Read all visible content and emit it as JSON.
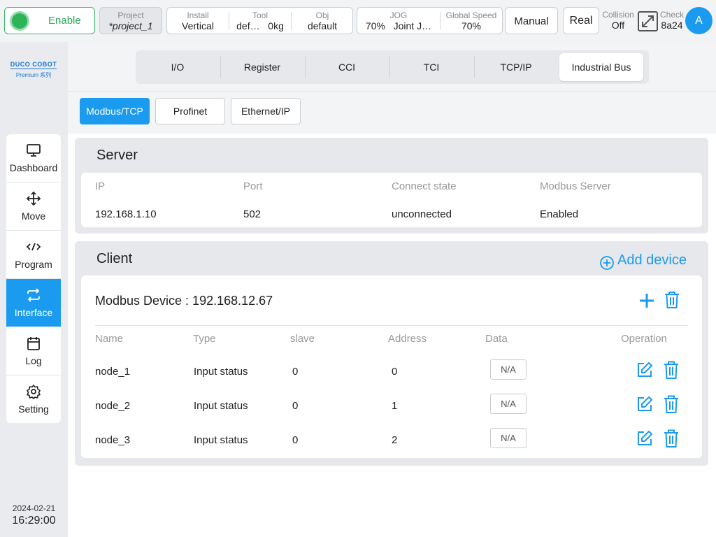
{
  "topbar": {
    "enable_label": "Enable",
    "project": {
      "label": "Project",
      "value": "*project_1"
    },
    "install": {
      "label": "Install",
      "value": "Vertical"
    },
    "tool": {
      "label": "Tool",
      "value1": "def…",
      "value2": "0kg"
    },
    "obj": {
      "label": "Obj",
      "value": "default"
    },
    "jog": {
      "label": "JOG",
      "value1": "70%",
      "value2": "Joint J…"
    },
    "global_speed": {
      "label": "Global Speed",
      "value": "70%"
    },
    "mode_label": "Manual",
    "real_label": "Real",
    "collision": {
      "label": "Collision",
      "value": "Off"
    },
    "check": {
      "label": "Check",
      "value": "8a24"
    },
    "avatar_letter": "A"
  },
  "sidebar": {
    "logo_brand": "DUCO COBOT",
    "logo_sub": "Premium 系列",
    "items": [
      {
        "label": "Dashboard"
      },
      {
        "label": "Move"
      },
      {
        "label": "Program"
      },
      {
        "label": "Interface"
      },
      {
        "label": "Log"
      },
      {
        "label": "Setting"
      }
    ],
    "date": "2024-02-21",
    "time": "16:29:00"
  },
  "main": {
    "tabs": [
      "I/O",
      "Register",
      "CCI",
      "TCI",
      "TCP/IP",
      "Industrial Bus"
    ],
    "active_tab": "Industrial Bus",
    "subtabs": [
      "Modbus/TCP",
      "Profinet",
      "Ethernet/IP"
    ],
    "active_subtab": "Modbus/TCP",
    "server": {
      "title": "Server",
      "headers": [
        "IP",
        "Port",
        "Connect state",
        "Modbus Server"
      ],
      "values": [
        "192.168.1.10",
        "502",
        "unconnected",
        "Enabled"
      ]
    },
    "client": {
      "title": "Client",
      "add_device_label": "Add device",
      "device_title": "Modbus Device : 192.168.12.67",
      "headers": [
        "Name",
        "Type",
        "slave",
        "Address",
        "Data",
        "Operation"
      ],
      "rows": [
        {
          "name": "node_1",
          "type": "Input status",
          "slave": "0",
          "address": "0",
          "data": "N/A"
        },
        {
          "name": "node_2",
          "type": "Input status",
          "slave": "0",
          "address": "1",
          "data": "N/A"
        },
        {
          "name": "node_3",
          "type": "Input status",
          "slave": "0",
          "address": "2",
          "data": "N/A"
        }
      ]
    }
  },
  "colors": {
    "accent": "#1a9bf0",
    "enable_green": "#2fb357"
  }
}
